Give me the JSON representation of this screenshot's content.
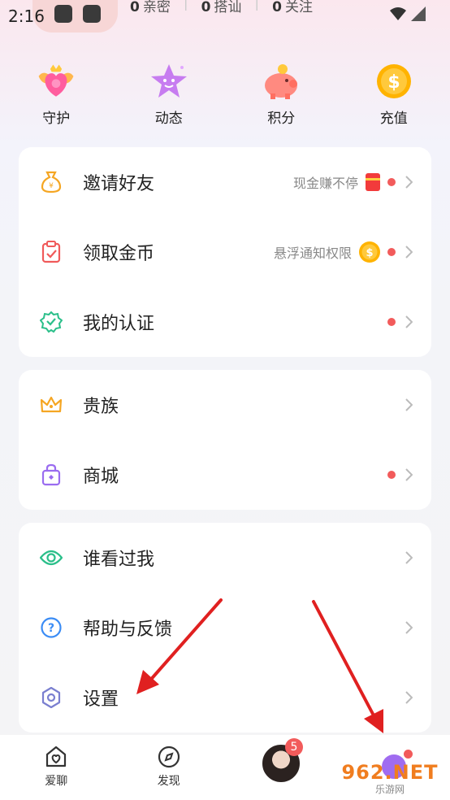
{
  "status_bar": {
    "time": "2:16"
  },
  "stats": [
    {
      "count": "0",
      "label": "亲密"
    },
    {
      "count": "0",
      "label": "搭讪"
    },
    {
      "count": "0",
      "label": "关注"
    }
  ],
  "quick_actions": [
    {
      "label": "守护",
      "icon": "guard-icon"
    },
    {
      "label": "动态",
      "icon": "star-face-icon"
    },
    {
      "label": "积分",
      "icon": "piggy-bank-icon"
    },
    {
      "label": "充值",
      "icon": "coin-icon"
    }
  ],
  "card1": {
    "items": [
      {
        "label": "邀请好友",
        "sub": "现金赚不停",
        "badge": "red-envelope-icon",
        "dot": true
      },
      {
        "label": "领取金币",
        "sub": "悬浮通知权限",
        "badge": "gold-coin-icon",
        "dot": true
      },
      {
        "label": "我的认证",
        "sub": "",
        "dot": true
      }
    ]
  },
  "card2": {
    "items": [
      {
        "label": "贵族",
        "dot": false
      },
      {
        "label": "商城",
        "dot": true
      }
    ]
  },
  "card3": {
    "items": [
      {
        "label": "谁看过我"
      },
      {
        "label": "帮助与反馈"
      },
      {
        "label": "设置"
      }
    ]
  },
  "tabbar": {
    "items": [
      {
        "label": "爱聊"
      },
      {
        "label": "发现"
      },
      {
        "label": "",
        "badge": "5"
      },
      {
        "label": ""
      }
    ]
  },
  "watermark": {
    "brand": "962.NET",
    "sub": "乐游网"
  },
  "colors": {
    "dot": "#f25b5b",
    "accent_purple": "#a06cf0",
    "accent_green": "#2bbf8a"
  }
}
